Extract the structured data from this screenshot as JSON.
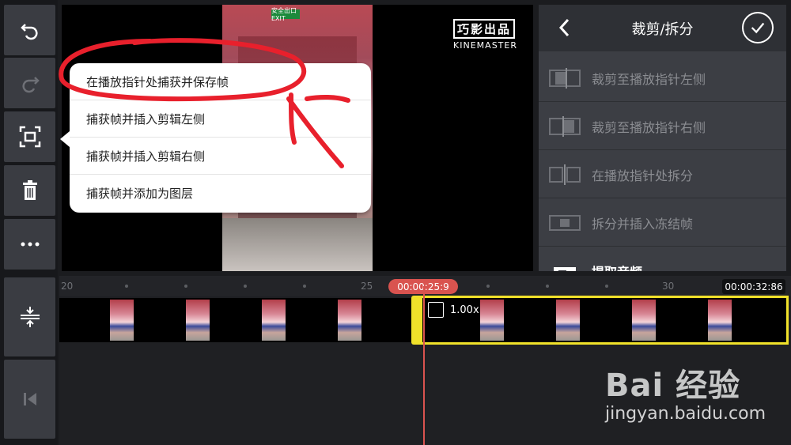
{
  "capture_menu": {
    "items": [
      "在播放指针处捕获并保存帧",
      "捕获帧并插入剪辑左侧",
      "捕获帧并插入剪辑右侧",
      "捕获帧并添加为图层"
    ]
  },
  "preview": {
    "logo_cn": "巧影出品",
    "logo_en": "KINEMASTER",
    "exit_sign": "安全出口 EXIT"
  },
  "right_panel": {
    "title": "裁剪/拆分",
    "items": [
      {
        "label": "裁剪至播放指针左侧",
        "icon": "trim-left-icon"
      },
      {
        "label": "裁剪至播放指针右侧",
        "icon": "trim-right-icon"
      },
      {
        "label": "在播放指针处拆分",
        "icon": "split-icon"
      },
      {
        "label": "拆分并插入冻结帧",
        "icon": "freeze-frame-icon"
      },
      {
        "label": "提取音频",
        "icon": "extract-audio-icon"
      }
    ]
  },
  "timeline": {
    "ticks": [
      "20",
      "25",
      "30"
    ],
    "current_time": "00:00:25:9",
    "total_time": "00:00:32:86",
    "speed": "1.00x"
  },
  "watermark": {
    "logo": "Bai 经验",
    "url": "jingyan.baidu.com"
  },
  "colors": {
    "accent_yellow": "#f0e12a",
    "playhead_red": "#d9534f",
    "annotation_red": "#e8202c"
  }
}
